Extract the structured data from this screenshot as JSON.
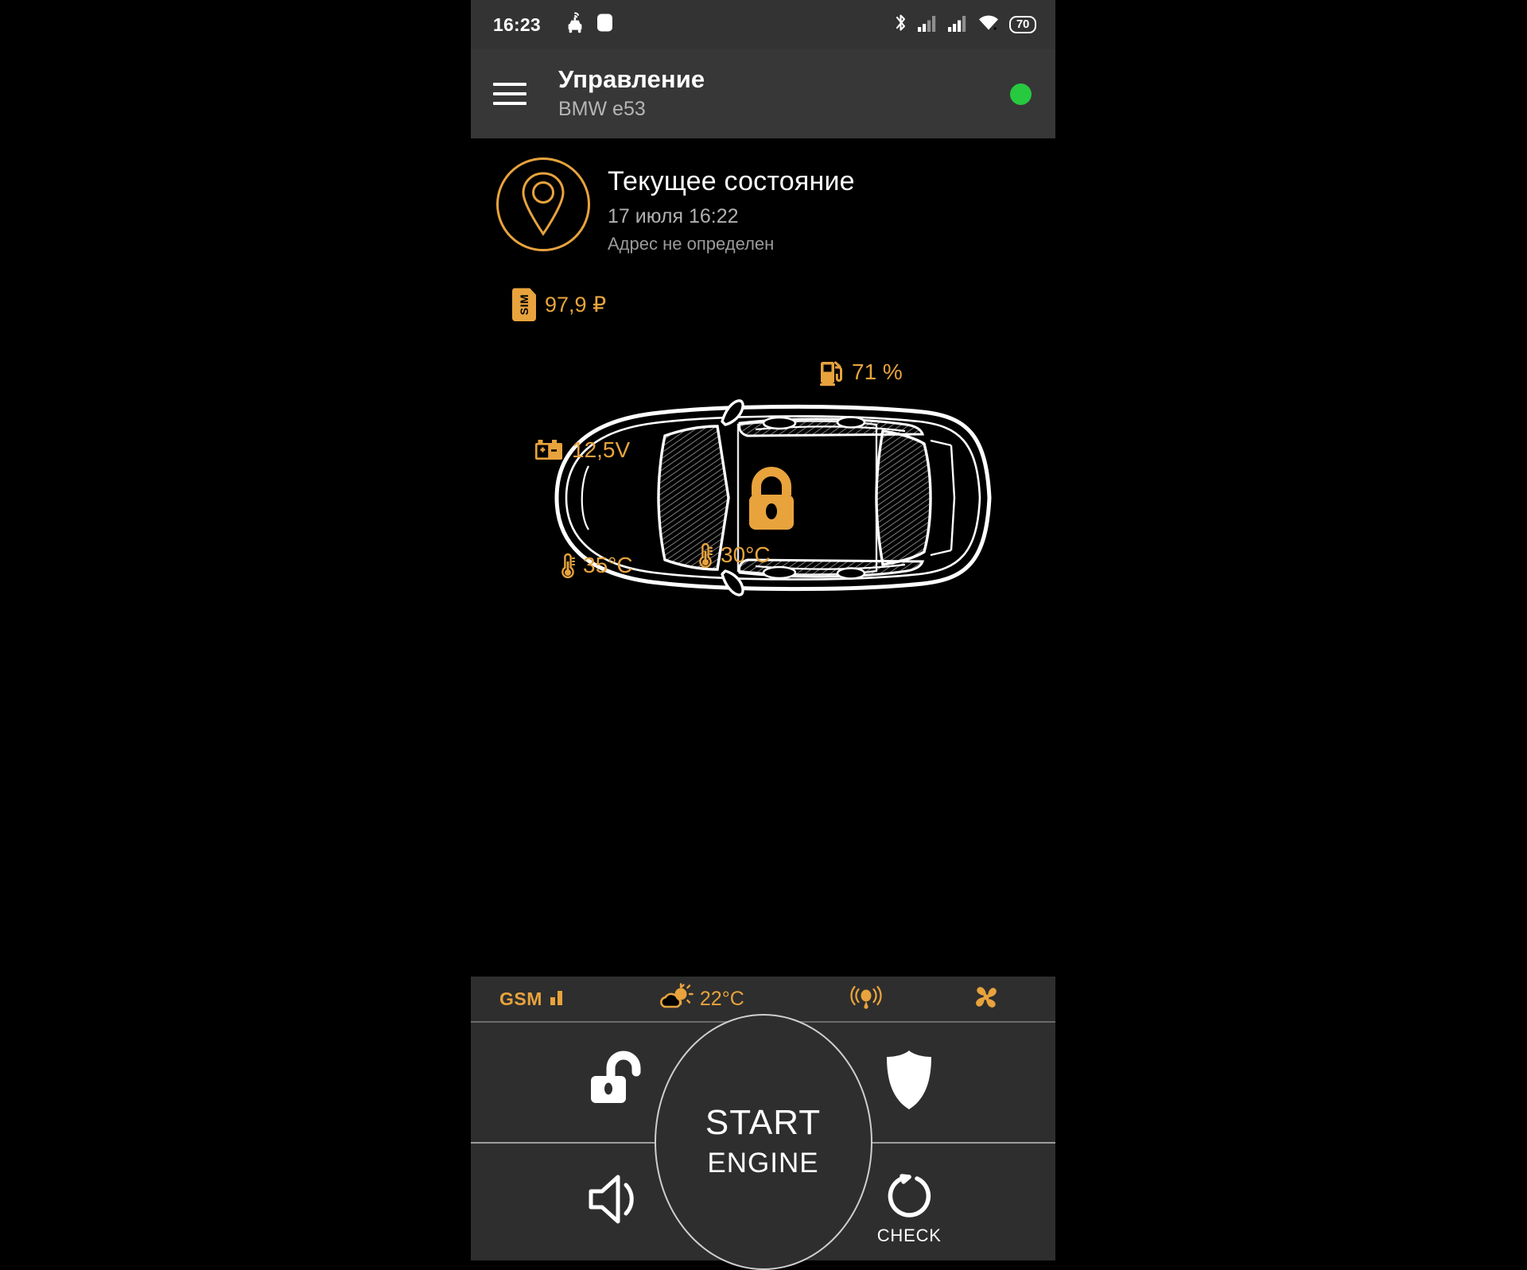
{
  "status_bar": {
    "time": "16:23",
    "icons_left": [
      "car-alarm-icon",
      "rounded-square-icon"
    ],
    "icons_right": [
      "bluetooth-icon",
      "signal-1-icon",
      "signal-2-icon",
      "wifi-icon"
    ],
    "battery": "70"
  },
  "app_bar": {
    "menu_icon": "hamburger-menu-icon",
    "title": "Управление",
    "subtitle": "BMW e53",
    "connection_state_color": "#27c93f"
  },
  "current_state": {
    "icon": "map-pin-icon",
    "title": "Текущее состояние",
    "timestamp": "17 июля 16:22",
    "address": "Адрес не определен"
  },
  "sim": {
    "icon_label": "SIM",
    "balance": "97,9 ₽"
  },
  "car_status": {
    "fuel": {
      "icon": "fuel-pump-icon",
      "value": "71 %"
    },
    "battery": {
      "icon": "car-battery-icon",
      "value": "12,5V"
    },
    "temp_outside": {
      "icon": "thermometer-icon",
      "value": "35°C"
    },
    "temp_cabin": {
      "icon": "thermometer-icon",
      "value": "30°C"
    },
    "lock": {
      "icon": "padlock-closed-icon",
      "state": "locked"
    }
  },
  "panel_status": {
    "gsm_label": "GSM",
    "gsm_icon": "signal-bars-icon",
    "weather_icon": "sun-behind-cloud-icon",
    "weather_temp": "22°C",
    "shock_sensor_icon": "shock-sensor-icon",
    "blower_icon": "fan-blower-icon"
  },
  "controls": {
    "unlock": {
      "icon": "padlock-open-icon",
      "name": "unlock-button"
    },
    "guard": {
      "icon": "shield-icon",
      "name": "guard-button"
    },
    "horn": {
      "icon": "speaker-horn-icon",
      "name": "horn-button"
    },
    "check": {
      "icon": "refresh-circle-icon",
      "label": "CHECK"
    },
    "start_engine": {
      "line1": "START",
      "line2": "ENGINE"
    }
  },
  "colors": {
    "accent": "#e8a33d",
    "panel_bg": "#2e2e2e",
    "appbar_bg": "#373737",
    "statusbar_bg": "#333333",
    "online": "#27c93f"
  }
}
